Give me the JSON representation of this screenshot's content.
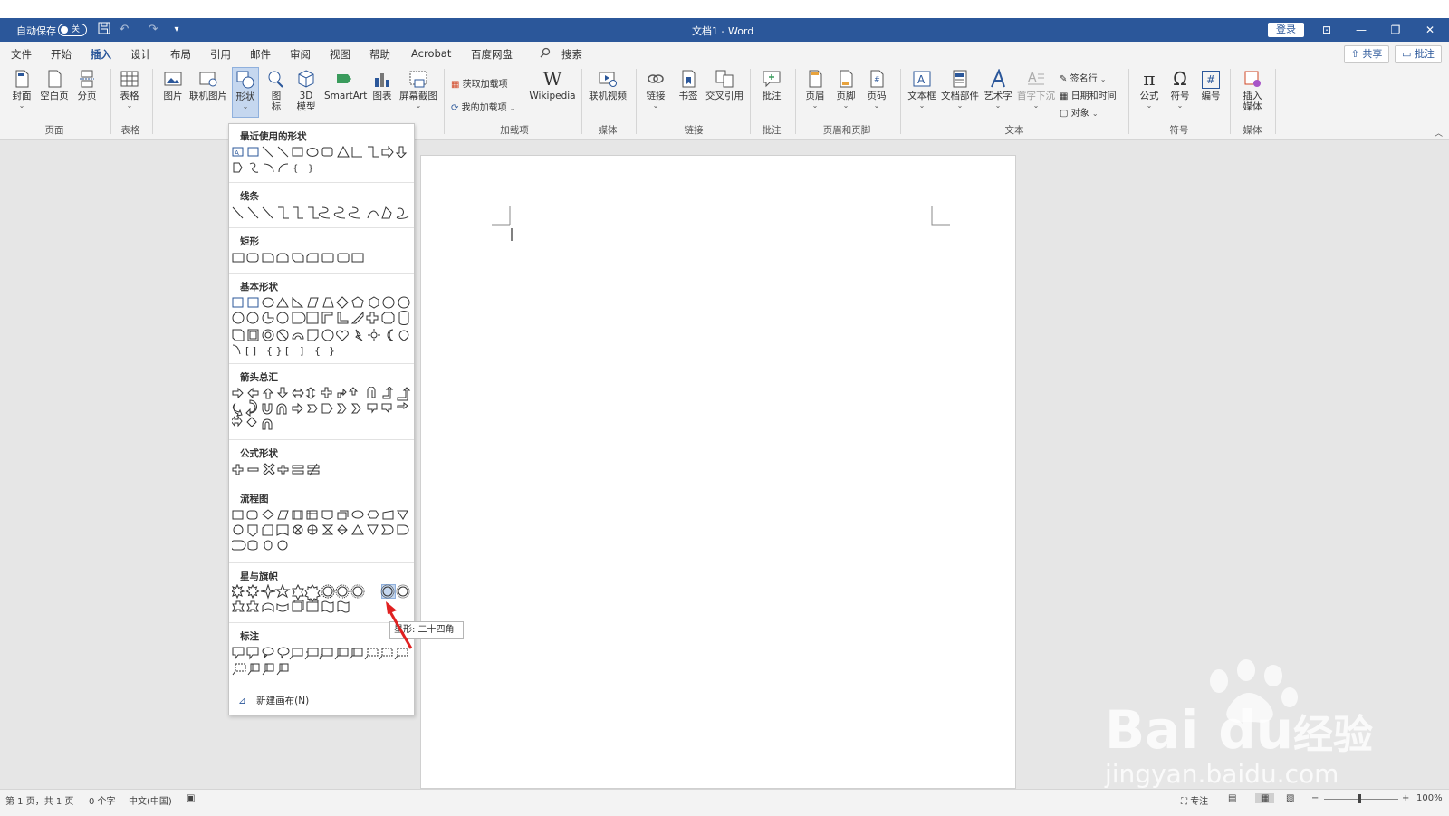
{
  "titlebar": {
    "autosave_label": "自动保存",
    "autosave_state": "关",
    "doc_title": "文档1 - Word",
    "login_label": "登录",
    "minimize_glyph": "—",
    "restore_glyph": "❐",
    "close_glyph": "✕",
    "ribbon_display_glyph": "⊡",
    "undo_glyph": "↶",
    "redo_glyph": "↷",
    "more_glyph": "▾"
  },
  "tabs": {
    "items": [
      "文件",
      "开始",
      "插入",
      "设计",
      "布局",
      "引用",
      "邮件",
      "审阅",
      "视图",
      "帮助",
      "Acrobat",
      "百度网盘"
    ],
    "active": "插入",
    "search_label": "搜索",
    "share_label": "共享",
    "comment_label": "批注"
  },
  "ribbon": {
    "page": {
      "cover": "封面",
      "blank": "空白页",
      "break": "分页",
      "group": "页面"
    },
    "table": {
      "table": "表格",
      "group": "表格"
    },
    "illus": {
      "picture": "图片",
      "online_picture": "联机图片",
      "shapes": "形状",
      "icons": "图",
      "icons2": "标",
      "model3d": "3D",
      "model3d2": "模型",
      "smartart": "SmartArt",
      "chart": "图表",
      "screenshot": "屏幕截图"
    },
    "addins": {
      "get": "获取加载项",
      "mine": "我的加载项",
      "wiki": "Wikipedia",
      "wiki_glyph": "W",
      "group": "加载项"
    },
    "media": {
      "video": "联机视频",
      "group": "媒体"
    },
    "links": {
      "link": "链接",
      "bookmark": "书签",
      "xref": "交叉引用",
      "group": "链接"
    },
    "comments": {
      "comment": "批注",
      "group": "批注"
    },
    "hf": {
      "header": "页眉",
      "footer": "页脚",
      "pagenum": "页码",
      "group": "页眉和页脚"
    },
    "text": {
      "textbox": "文本框",
      "parts": "文档部件",
      "wordart": "艺术字",
      "dropcap": "首字下沉",
      "sigline": "签名行",
      "datetime": "日期和时间",
      "object": "对象",
      "group": "文本"
    },
    "symbols": {
      "equation": "公式",
      "equation_glyph": "π",
      "symbol": "符号",
      "symbol_glyph": "Ω",
      "number": "编号",
      "number_glyph": "#",
      "group": "符号"
    },
    "media2": {
      "insert": "插入",
      "insert2": "媒体",
      "group": "媒体"
    }
  },
  "shapes_menu": {
    "sections": [
      "最近使用的形状",
      "线条",
      "矩形",
      "基本形状",
      "箭头总汇",
      "公式形状",
      "流程图",
      "星与旗帜",
      "标注"
    ],
    "new_canvas": "新建画布(N)"
  },
  "tooltip": {
    "text": "星形: 二十四角"
  },
  "status": {
    "page": "第 1 页，共 1 页",
    "words": "0 个字",
    "lang": "中文(中国)",
    "focus": "专注",
    "zoom": "100%",
    "zoom_minus": "−",
    "zoom_plus": "+"
  },
  "watermark": {
    "brand": "Bai",
    "brand2": "du",
    "cn": "经验",
    "url": "jingyan.baidu.com"
  },
  "colors": {
    "accent": "#2b579a",
    "pointer": "#e02020"
  }
}
